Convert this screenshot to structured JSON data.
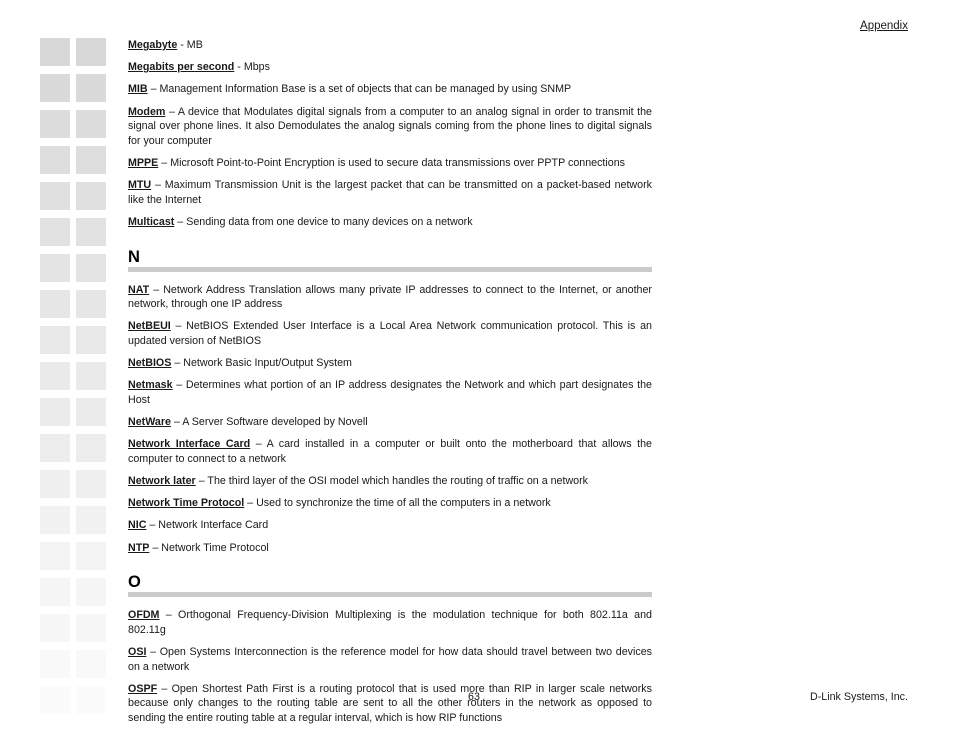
{
  "header": {
    "title": "Appendix"
  },
  "sidebar": {
    "name": "page-thumbnail-strip",
    "columns": 2,
    "rows": 19,
    "base_color": "#d9d7d7"
  },
  "content": {
    "entries_before_n": [
      {
        "term": "Megabyte",
        "separator": " - ",
        "definition": "MB"
      },
      {
        "term": "Megabits per second",
        "separator": " - ",
        "definition": "Mbps"
      },
      {
        "term": "MIB",
        "separator": " – ",
        "definition": "Management Information Base is a set of objects that can be managed by using SNMP"
      },
      {
        "term": "Modem",
        "separator": " – ",
        "definition": "A device that Modulates digital signals from a computer to an analog signal in order to transmit the signal over phone lines.  It also Demodulates the analog signals coming from the phone lines to digital signals for your computer"
      },
      {
        "term": "MPPE",
        "separator": " – ",
        "definition": "Microsoft Point-to-Point Encryption is used to secure data transmissions over PPTP connections"
      },
      {
        "term": "MTU",
        "separator": " – ",
        "definition": "Maximum Transmission Unit is the largest packet that can be transmitted on a packet-based network like the Internet"
      },
      {
        "term": "Multicast",
        "separator": " – ",
        "definition": "Sending data from one device to many devices on a network"
      }
    ],
    "section_n": {
      "letter": "N",
      "entries": [
        {
          "term": "NAT",
          "separator": " – ",
          "definition": "Network Address Translation allows many private IP addresses to connect to the Internet, or another network, through one IP address"
        },
        {
          "term": "NetBEUI",
          "separator": " – ",
          "definition": "NetBIOS Extended User Interface is a Local Area Network communication protocol.  This is an updated version of NetBIOS"
        },
        {
          "term": "NetBIOS",
          "separator": " – ",
          "definition": "Network Basic Input/Output System"
        },
        {
          "term": "Netmask",
          "separator": " – ",
          "definition": "Determines what portion of an IP address designates the Network and which part designates the Host"
        },
        {
          "term": "NetWare",
          "separator": " – ",
          "definition": "A Server Software developed by Novell"
        },
        {
          "term": "Network Interface Card",
          "separator": " – ",
          "definition": "A card installed in a computer or built onto the motherboard that allows the computer to connect to a network"
        },
        {
          "term": "Network later",
          "separator": " – ",
          "definition": "The third layer of the OSI model which handles the routing of traffic on a network"
        },
        {
          "term": "Network Time Protocol",
          "separator": " – ",
          "definition": "Used to synchronize the time of all the computers in a network"
        },
        {
          "term": "NIC",
          "separator": " – ",
          "definition": "Network Interface Card"
        },
        {
          "term": "NTP",
          "separator": " – ",
          "definition": "Network Time Protocol"
        }
      ]
    },
    "section_o": {
      "letter": "O",
      "entries": [
        {
          "term": "OFDM",
          "separator": " – ",
          "definition": "Orthogonal Frequency-Division Multiplexing is the modulation technique for both 802.11a and 802.11g"
        },
        {
          "term": "OSI",
          "separator": " – ",
          "definition": "Open Systems Interconnection is the reference model for how data should travel between two devices on a network"
        },
        {
          "term": "OSPF",
          "separator": " – ",
          "definition": "Open Shortest Path First is a routing protocol that is used more than RIP in larger scale networks because only changes to the routing table are sent to all the other routers in the network as opposed to sending the entire routing table at a regular interval, which is how RIP functions"
        }
      ]
    }
  },
  "footer": {
    "page_number": "63",
    "company": "D-Link Systems, Inc."
  }
}
